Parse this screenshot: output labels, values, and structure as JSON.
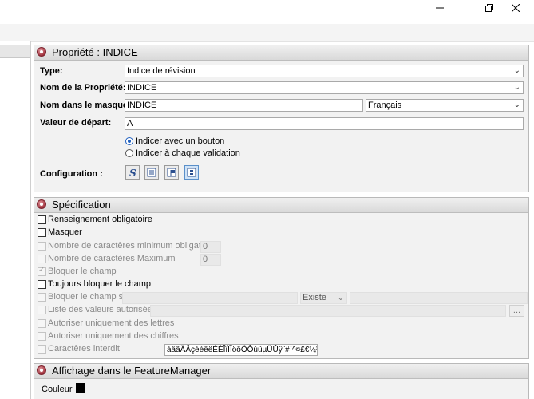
{
  "window": {
    "min_icon": "minimize-icon",
    "max_icon": "restore-icon",
    "close_icon": "close-icon"
  },
  "prop_panel": {
    "title": "Propriété :  INDICE",
    "type_label": "Type:",
    "type_value": "Indice de révision",
    "name_label": "Nom de la Propriété:",
    "name_value": "INDICE",
    "mask_label": "Nom dans le masque:",
    "mask_value": "INDICE",
    "lang_value": "Français",
    "start_label": "Valeur de départ:",
    "start_value": "A",
    "radio1": "Indicer avec un bouton",
    "radio2": "Indicer à chaque validation",
    "config_label": "Configuration :"
  },
  "spec_panel": {
    "title": "Spécification",
    "required": "Renseignement obligatoire",
    "hide": "Masquer",
    "min_chars": "Nombre de caractères minimum obligatoires",
    "min_value": "0",
    "max_chars": "Nombre de caractères Maximum",
    "max_value": "0",
    "lock": "Bloquer le champ",
    "always_lock": "Toujours bloquer le champ",
    "lock_if": "Bloquer le champ si",
    "exists_value": "Existe",
    "allowed_list": "Liste des valeurs autorisées:",
    "browse": "...",
    "letters_only": "Autoriser uniquement des lettres",
    "digits_only": "Autoriser uniquement des chiffres",
    "forbidden": "Caractères interdit",
    "forbidden_value": "àäâÄÂçéèêëÉÈÎïÏÎöôÖÔùüµÜÛÿ¨#`^¤£€¼½¾"
  },
  "feature_panel": {
    "title": "Affichage dans le FeatureManager",
    "color_label": "Couleur",
    "color_value": "#000000"
  },
  "colors": {
    "accent": "#1f5fbf",
    "bullet": "#a0323d"
  }
}
